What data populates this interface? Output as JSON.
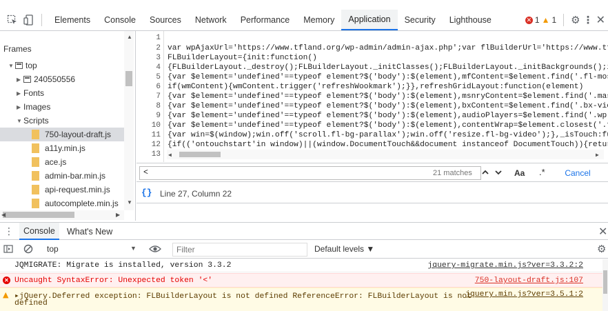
{
  "toolbar": {
    "tabs": [
      "Elements",
      "Console",
      "Sources",
      "Network",
      "Performance",
      "Memory",
      "Application",
      "Security",
      "Lighthouse"
    ],
    "active_tab": "Application",
    "error_count": "1",
    "warning_count": "1"
  },
  "sidebar": {
    "heading": "Frames",
    "items": [
      {
        "label": "top"
      },
      {
        "label": "240550556"
      },
      {
        "label": "Fonts"
      },
      {
        "label": "Images"
      },
      {
        "label": "Scripts"
      },
      {
        "label": "750-layout-draft.js"
      },
      {
        "label": "a11y.min.js"
      },
      {
        "label": "ace.js"
      },
      {
        "label": "admin-bar.min.js"
      },
      {
        "label": "api-request.min.js"
      },
      {
        "label": "autocomplete.min.js"
      }
    ]
  },
  "code": {
    "line_numbers": [
      "1",
      "2",
      "3",
      "4",
      "5",
      "6",
      "7",
      "8",
      "9",
      "10",
      "11",
      "12",
      "13"
    ],
    "lines": [
      "",
      "var wpAjaxUrl='https://www.tfland.org/wp-admin/admin-ajax.php';var flBuilderUrl='https://www.tfl",
      "FLBuilderLayout={init:function()",
      "{FLBuilderLayout._destroy();FLBuilderLayout._initClasses();FLBuilderLayout._initBackgrounds();if",
      "{var $element='undefined'==typeof element?$('body'):$(element),mfContent=$element.find('.fl-mosa",
      "if(wmContent){wmContent.trigger('refreshWookmark');}},refreshGridLayout:function(element)",
      "{var $element='undefined'==typeof element?$('body'):$(element),msnryContent=$element.find('.maso",
      "{var $element='undefined'==typeof element?$('body'):$(element),bxContent=$element.find('.bx-view",
      "{var $element='undefined'==typeof element?$('body'):$(element),audioPlayers=$element.find('.wp-a",
      "{var $element='undefined'==typeof element?$('body'):$(element),contentWrap=$element.closest('.fl",
      "{var win=$(window);win.off('scroll.fl-bg-parallax');win.off('resize.fl-bg-video');},_isTouch:fun",
      "{if(('ontouchstart'in window)||(window.DocumentTouch&&document instanceof DocumentTouch)){return",
      ""
    ]
  },
  "search": {
    "query": "<",
    "matches": "21 matches",
    "match_case": "Aa",
    "regex": ".*",
    "cancel_label": "Cancel"
  },
  "status": {
    "braces": "{}",
    "position": "Line 27, Column 22"
  },
  "drawer": {
    "tabs": [
      "Console",
      "What's New"
    ],
    "context": "top",
    "filter_placeholder": "Filter",
    "levels": "Default levels"
  },
  "console": {
    "messages": [
      {
        "level": "info",
        "text": "JQMIGRATE: Migrate is installed, version 3.3.2",
        "source": "jquery-migrate.min.js?ver=3.3.2:2"
      },
      {
        "level": "error",
        "text": "Uncaught SyntaxError: Unexpected token '<'",
        "source": "750-layout-draft.js:107"
      },
      {
        "level": "warning",
        "text": "jQuery.Deferred exception: FLBuilderLayout is not defined ReferenceError: FLBuilderLayout is not",
        "text2": "defined",
        "source": "jquery.min.js?ver=3.5.1:2"
      }
    ]
  }
}
